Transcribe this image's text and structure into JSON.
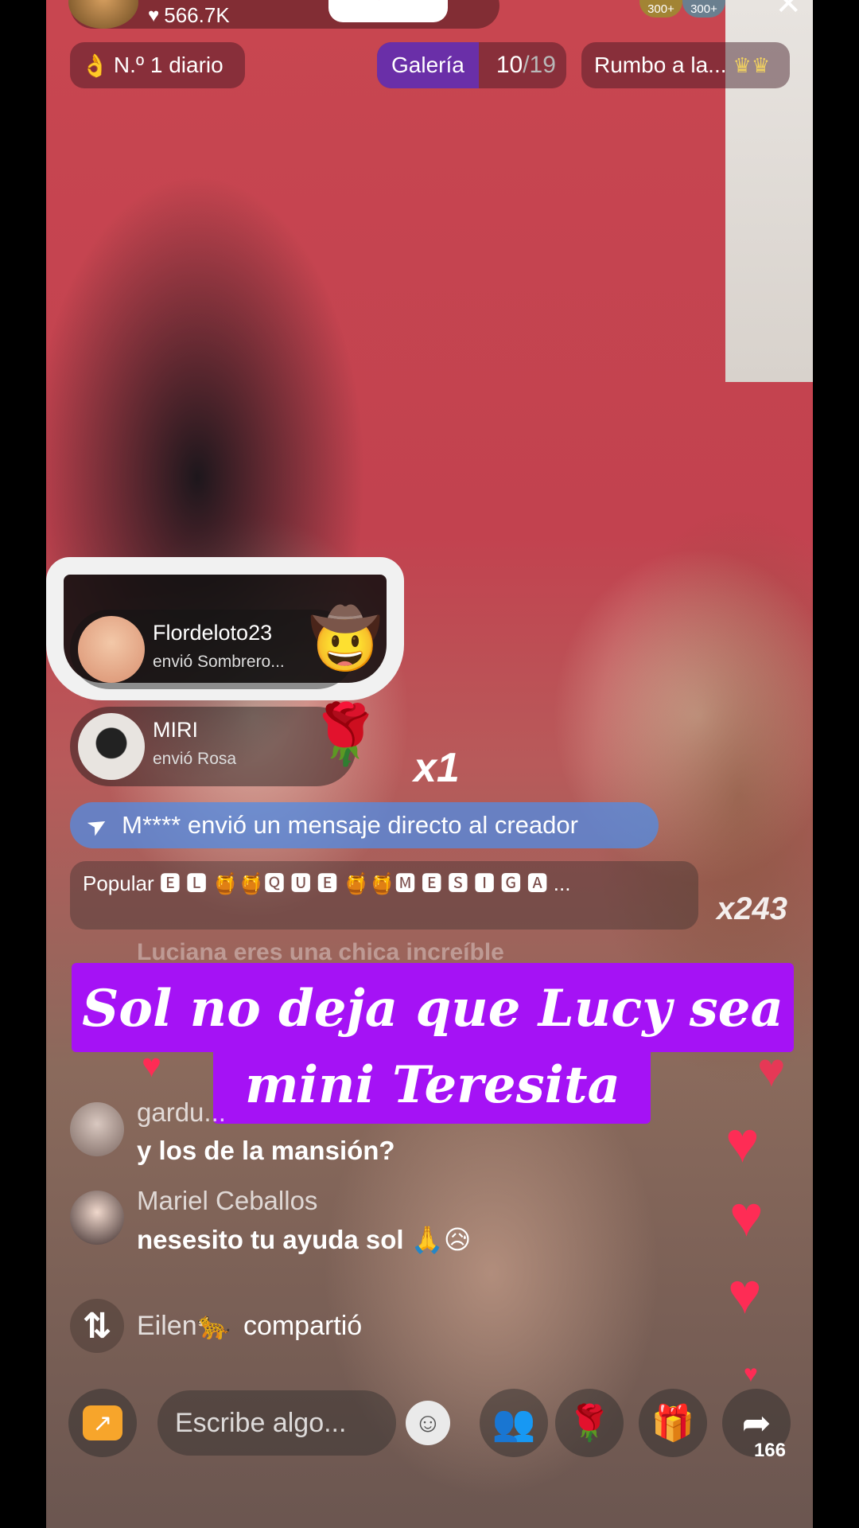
{
  "header": {
    "likes": "566.7K",
    "daily_rank": "N.º 1 diario",
    "gallery": {
      "label": "Galería",
      "current": "10",
      "total": "/19"
    },
    "rumbo": "Rumbo a la...",
    "badges": [
      "300+",
      "300+"
    ]
  },
  "gifts": [
    {
      "user": "Flordeloto23",
      "action": "envió Sombrero..."
    },
    {
      "user": "MIRI",
      "action": "envió Rosa",
      "combo": "x1"
    }
  ],
  "dm_banner": "M**** envió un mensaje directo al creador",
  "popular": {
    "label": "Popular",
    "text": "🅴 🅻 🍯🍯🆀 🆄 🅴 🍯🍯🅼 🅴 🆂 🅸 🅶 🅰 ...",
    "combo": "x243"
  },
  "faded_comment": "Luciana eres una chica increíble",
  "caption": {
    "line1": "Sol no deja que Lucy sea",
    "line2": "mini Teresita"
  },
  "comments": [
    {
      "user": "gardu...",
      "message": "y los de la mansión?"
    },
    {
      "user": "Mariel Ceballos",
      "message": "nesesito tu ayuda sol 🙏😥"
    }
  ],
  "share_event": {
    "user": "Eilen🐆",
    "action": "compartió"
  },
  "bottom": {
    "input_placeholder": "Escribe algo...",
    "share_count": "166"
  },
  "colors": {
    "caption_bg": "#a512f5",
    "accent": "#fe2c55",
    "gallery_label_bg": "#6a2fa8"
  }
}
